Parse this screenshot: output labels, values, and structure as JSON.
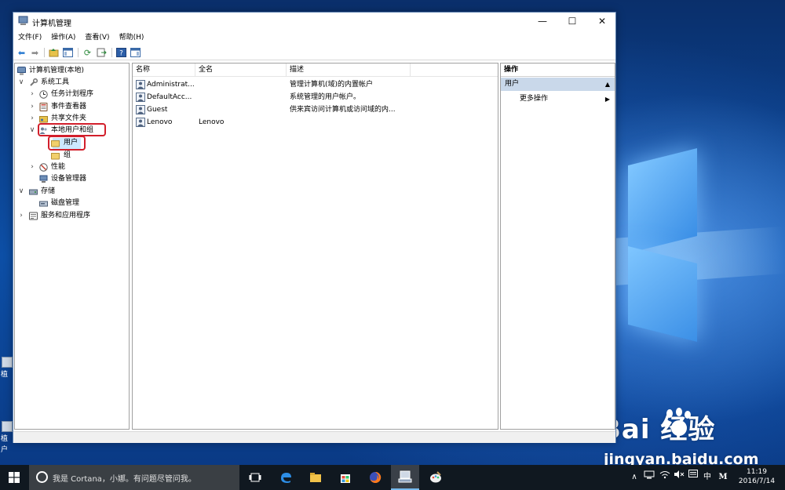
{
  "window": {
    "title": "计算机管理",
    "minimize_glyph": "—",
    "maximize_glyph": "☐",
    "close_glyph": "✕"
  },
  "menu": [
    "文件(F)",
    "操作(A)",
    "查看(V)",
    "帮助(H)"
  ],
  "toolbar": {
    "icons": [
      "back-arrow-icon",
      "forward-arrow-icon",
      "up-folder-icon",
      "show-hide-tree-icon",
      "refresh-icon",
      "export-list-icon",
      "help-icon",
      "show-hide-action-pane-icon"
    ]
  },
  "tree": {
    "root": "计算机管理(本地)",
    "items": [
      {
        "label": "系统工具",
        "level": 1,
        "expanded": true
      },
      {
        "label": "任务计划程序",
        "level": 2,
        "expanded": false
      },
      {
        "label": "事件查看器",
        "level": 2,
        "expanded": false
      },
      {
        "label": "共享文件夹",
        "level": 2,
        "expanded": false
      },
      {
        "label": "本地用户和组",
        "level": 2,
        "expanded": true
      },
      {
        "label": "用户",
        "level": 3,
        "selected": true
      },
      {
        "label": "组",
        "level": 3
      },
      {
        "label": "性能",
        "level": 2,
        "expanded": false
      },
      {
        "label": "设备管理器",
        "level": 2
      },
      {
        "label": "存储",
        "level": 1,
        "expanded": true
      },
      {
        "label": "磁盘管理",
        "level": 2
      },
      {
        "label": "服务和应用程序",
        "level": 1,
        "expanded": false
      }
    ]
  },
  "list": {
    "columns": [
      "名称",
      "全名",
      "描述"
    ],
    "rows": [
      {
        "name": "Administrat...",
        "fullname": "",
        "desc": "管理计算机(域)的内置帐户"
      },
      {
        "name": "DefaultAcc...",
        "fullname": "",
        "desc": "系统管理的用户帐户。"
      },
      {
        "name": "Guest",
        "fullname": "",
        "desc": "供来宾访问计算机或访问域的内..."
      },
      {
        "name": "Lenovo",
        "fullname": "Lenovo",
        "desc": ""
      }
    ]
  },
  "actions": {
    "title": "操作",
    "section": "用户",
    "item": "更多操作"
  },
  "taskbar": {
    "search_placeholder": "我是 Cortana，小娜。有问题尽管问我。",
    "apps": [
      "task-view-icon",
      "edge-icon",
      "file-explorer-icon",
      "store-icon",
      "firefox-icon",
      "computer-management-icon",
      "paint-icon"
    ],
    "ime_label": "中",
    "ime_mode": "M",
    "time": "11:19",
    "date": "2016/7/14"
  },
  "watermark": {
    "brand": "Bai  经验",
    "url": "jingyan.baidu.com"
  },
  "desktop": {
    "icon_labels": [
      "植",
      "植",
      "户"
    ]
  },
  "colors": {
    "highlight_red": "#d21f2b",
    "selection": "#cce8ff",
    "action_section": "#c9d8ea",
    "taskbar": "#101820"
  }
}
